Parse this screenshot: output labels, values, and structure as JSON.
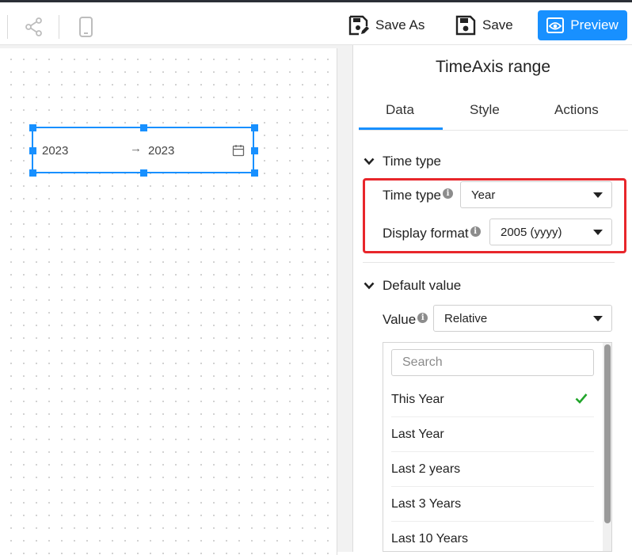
{
  "toolbar": {
    "save_as_label": "Save As",
    "save_label": "Save",
    "preview_label": "Preview"
  },
  "canvas": {
    "widget": {
      "start_value": "2023",
      "separator": "→",
      "end_value": "2023"
    }
  },
  "panel": {
    "title": "TimeAxis range",
    "tabs": [
      "Data",
      "Style",
      "Actions"
    ],
    "active_tab": "Data",
    "time_type_section": {
      "heading": "Time type",
      "time_type_label": "Time type",
      "time_type_value": "Year",
      "display_format_label": "Display format",
      "display_format_value": "2005 (yyyy)"
    },
    "default_value_section": {
      "heading": "Default value",
      "value_label": "Value",
      "value_selected": "Relative"
    },
    "dropdown": {
      "search_placeholder": "Search",
      "options": [
        "This Year",
        "Last Year",
        "Last 2 years",
        "Last 3 Years",
        "Last 10 Years"
      ],
      "selected_option": "This Year"
    }
  },
  "colors": {
    "accent": "#1890ff",
    "highlight": "#e8262b",
    "check": "#22a52b"
  }
}
